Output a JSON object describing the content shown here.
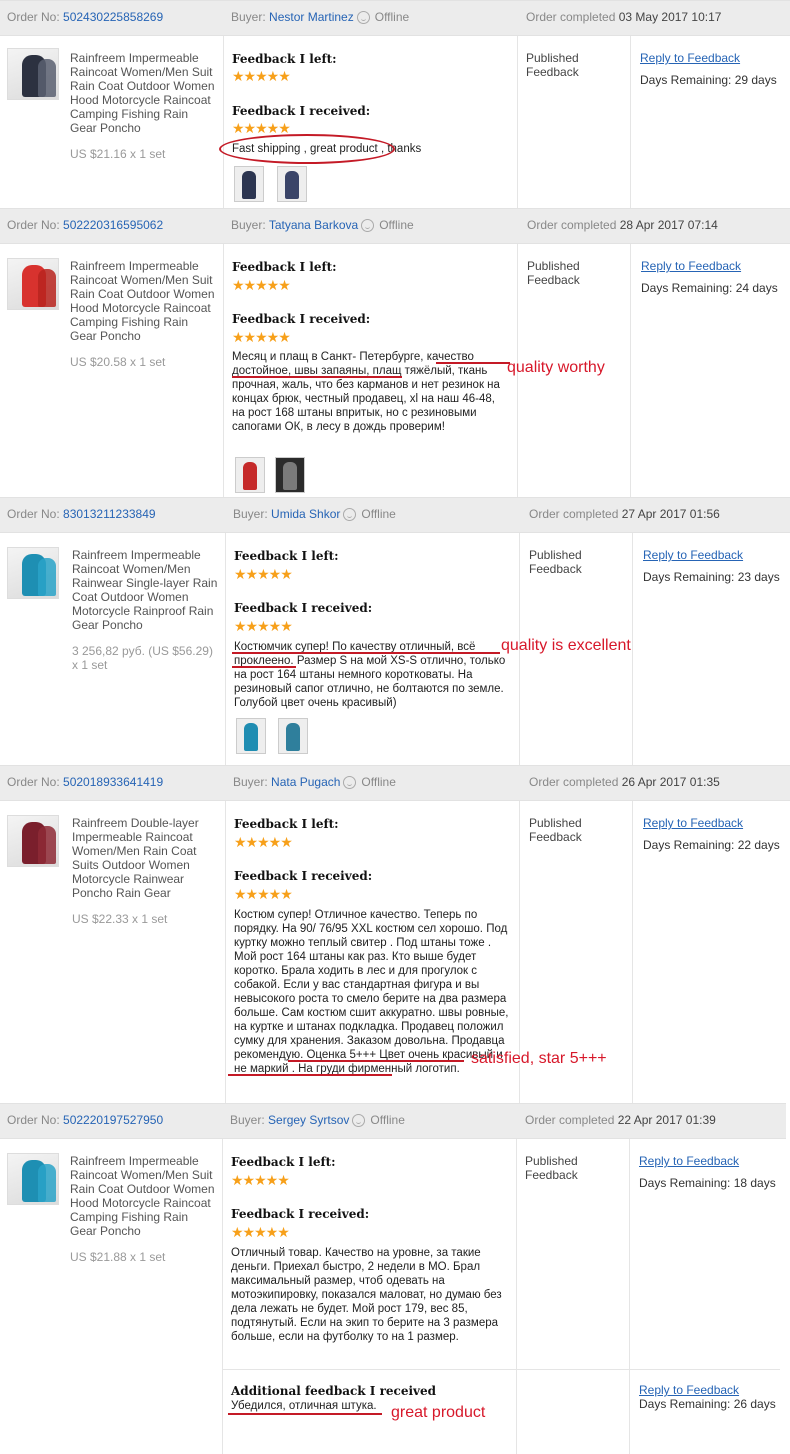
{
  "labels": {
    "order_no": "Order No:",
    "buyer": "Buyer:",
    "offline": "Offline",
    "order_completed": "Order completed",
    "feedback_left": "Feedback I left:",
    "feedback_received": "Feedback I received:",
    "published": "Published\nFeedback",
    "reply": "Reply to Feedback",
    "stars": "★★★★★",
    "additional": "Additional feedback I received"
  },
  "orders": [
    {
      "order_no": "502430225858269",
      "buyer": "Nestor Martinez",
      "completed": "03 May 2017 10:17",
      "product": "Rainfreem Impermeable Raincoat Women/Men Suit Rain Coat Outdoor Women Hood Motorcycle Raincoat Camping Fishing Rain Gear Poncho",
      "price": "US $21.16 x 1 set",
      "received_text": "Fast shipping , great product , thanks",
      "days": "Days Remaining: 29 days"
    },
    {
      "order_no": "502220316595062",
      "buyer": "Tatyana Barkova",
      "completed": "28 Apr 2017 07:14",
      "product": "Rainfreem Impermeable Raincoat Women/Men Suit Rain Coat Outdoor Women Hood Motorcycle Raincoat Camping Fishing Rain Gear Poncho",
      "price": "US $20.58 x 1 set",
      "received_text": "Месяц и плащ в Санкт- Петербурге, качество достойное, швы запаяны, плащ тяжёлый, ткань прочная, жаль, что без карманов и нет резинок на концах брюк, честный продавец, xl на наш 46-48, на рост 168 штаны впритык, но с резиновыми сапогами ОК, в лесу в дождь проверим!",
      "days": "Days Remaining: 24 days"
    },
    {
      "order_no": "83013211233849",
      "buyer": "Umida Shkor",
      "completed": "27 Apr 2017 01:56",
      "product": "Rainfreem Impermeable Raincoat Women/Men Rainwear Single-layer Rain Coat Outdoor Women Motorcycle Rainproof Rain Gear Poncho",
      "price": "3 256,82 руб. (US $56.29) x 1 set",
      "received_text": "Костюмчик супер! По качеству отличный, всё проклеено. Размер S на мой XS-S отлично, только на рост 164 штаны немного коротковаты. На резиновый сапог отлично, не болтаются по земле. Голубой цвет очень красивый)",
      "days": "Days Remaining: 23 days"
    },
    {
      "order_no": "502018933641419",
      "buyer": "Nata Pugach",
      "completed": "26 Apr 2017 01:35",
      "product": "Rainfreem Double-layer Impermeable Raincoat Women/Men Rain Coat Suits Outdoor Women Motorcycle Rainwear Poncho Rain Gear",
      "price": "US $22.33 x 1 set",
      "received_text": "Костюм супер! Отличное качество. Теперь по порядку. На 90/ 76/95 XXL костюм сел хорошо. Под куртку можно теплый свитер . Под штаны тоже . Мой рост 164 штаны как раз. Кто выше будет коротко. Брала ходить в лес и для прогулок с собакой. Если у вас стандартная фигура и вы невысокого роста то смело берите на два размера больше. Сам костюм сшит аккуратно. швы ровные, на куртке и штанах подкладка. Продавец положил сумку для хранения. Заказом довольна. Продавца рекомендую. Оценка 5+++ Цвет очень красивый и не маркий . На груди фирменный логотип.",
      "days": "Days Remaining: 22 days"
    },
    {
      "order_no": "502220197527950",
      "buyer": "Sergey Syrtsov",
      "completed": "22 Apr 2017 01:39",
      "product": "Rainfreem Impermeable Raincoat Women/Men Suit Rain Coat Outdoor Women Hood Motorcycle Raincoat Camping Fishing Rain Gear Poncho",
      "price": "US $21.88 x 1 set",
      "received_text": "Отличный товар. Качество на уровне, за такие деньги. Приехал быстро, 2 недели в МО. Брал максимальный размер, чтоб одевать на мотоэкипировку, показался маловат, но думаю без дела лежать не будет. Мой рост 179, вес 85, подтянутый. Если на экип то берите на 3 размера больше, если на футболку то на 1 размер.",
      "days": "Days Remaining: 18 days",
      "additional_text": "Убедился, отличная штука.",
      "additional_days": "Days Remaining: 26 days"
    }
  ],
  "annotations": {
    "a2": "quality worthy",
    "a3": "quality is excellent",
    "a4": "satisfied, star 5+++",
    "a5": "great product"
  },
  "colors": {
    "link": "#2664b5",
    "star": "#f7a01a",
    "annotation": "#d7182a",
    "header_bg": "#ececec"
  }
}
